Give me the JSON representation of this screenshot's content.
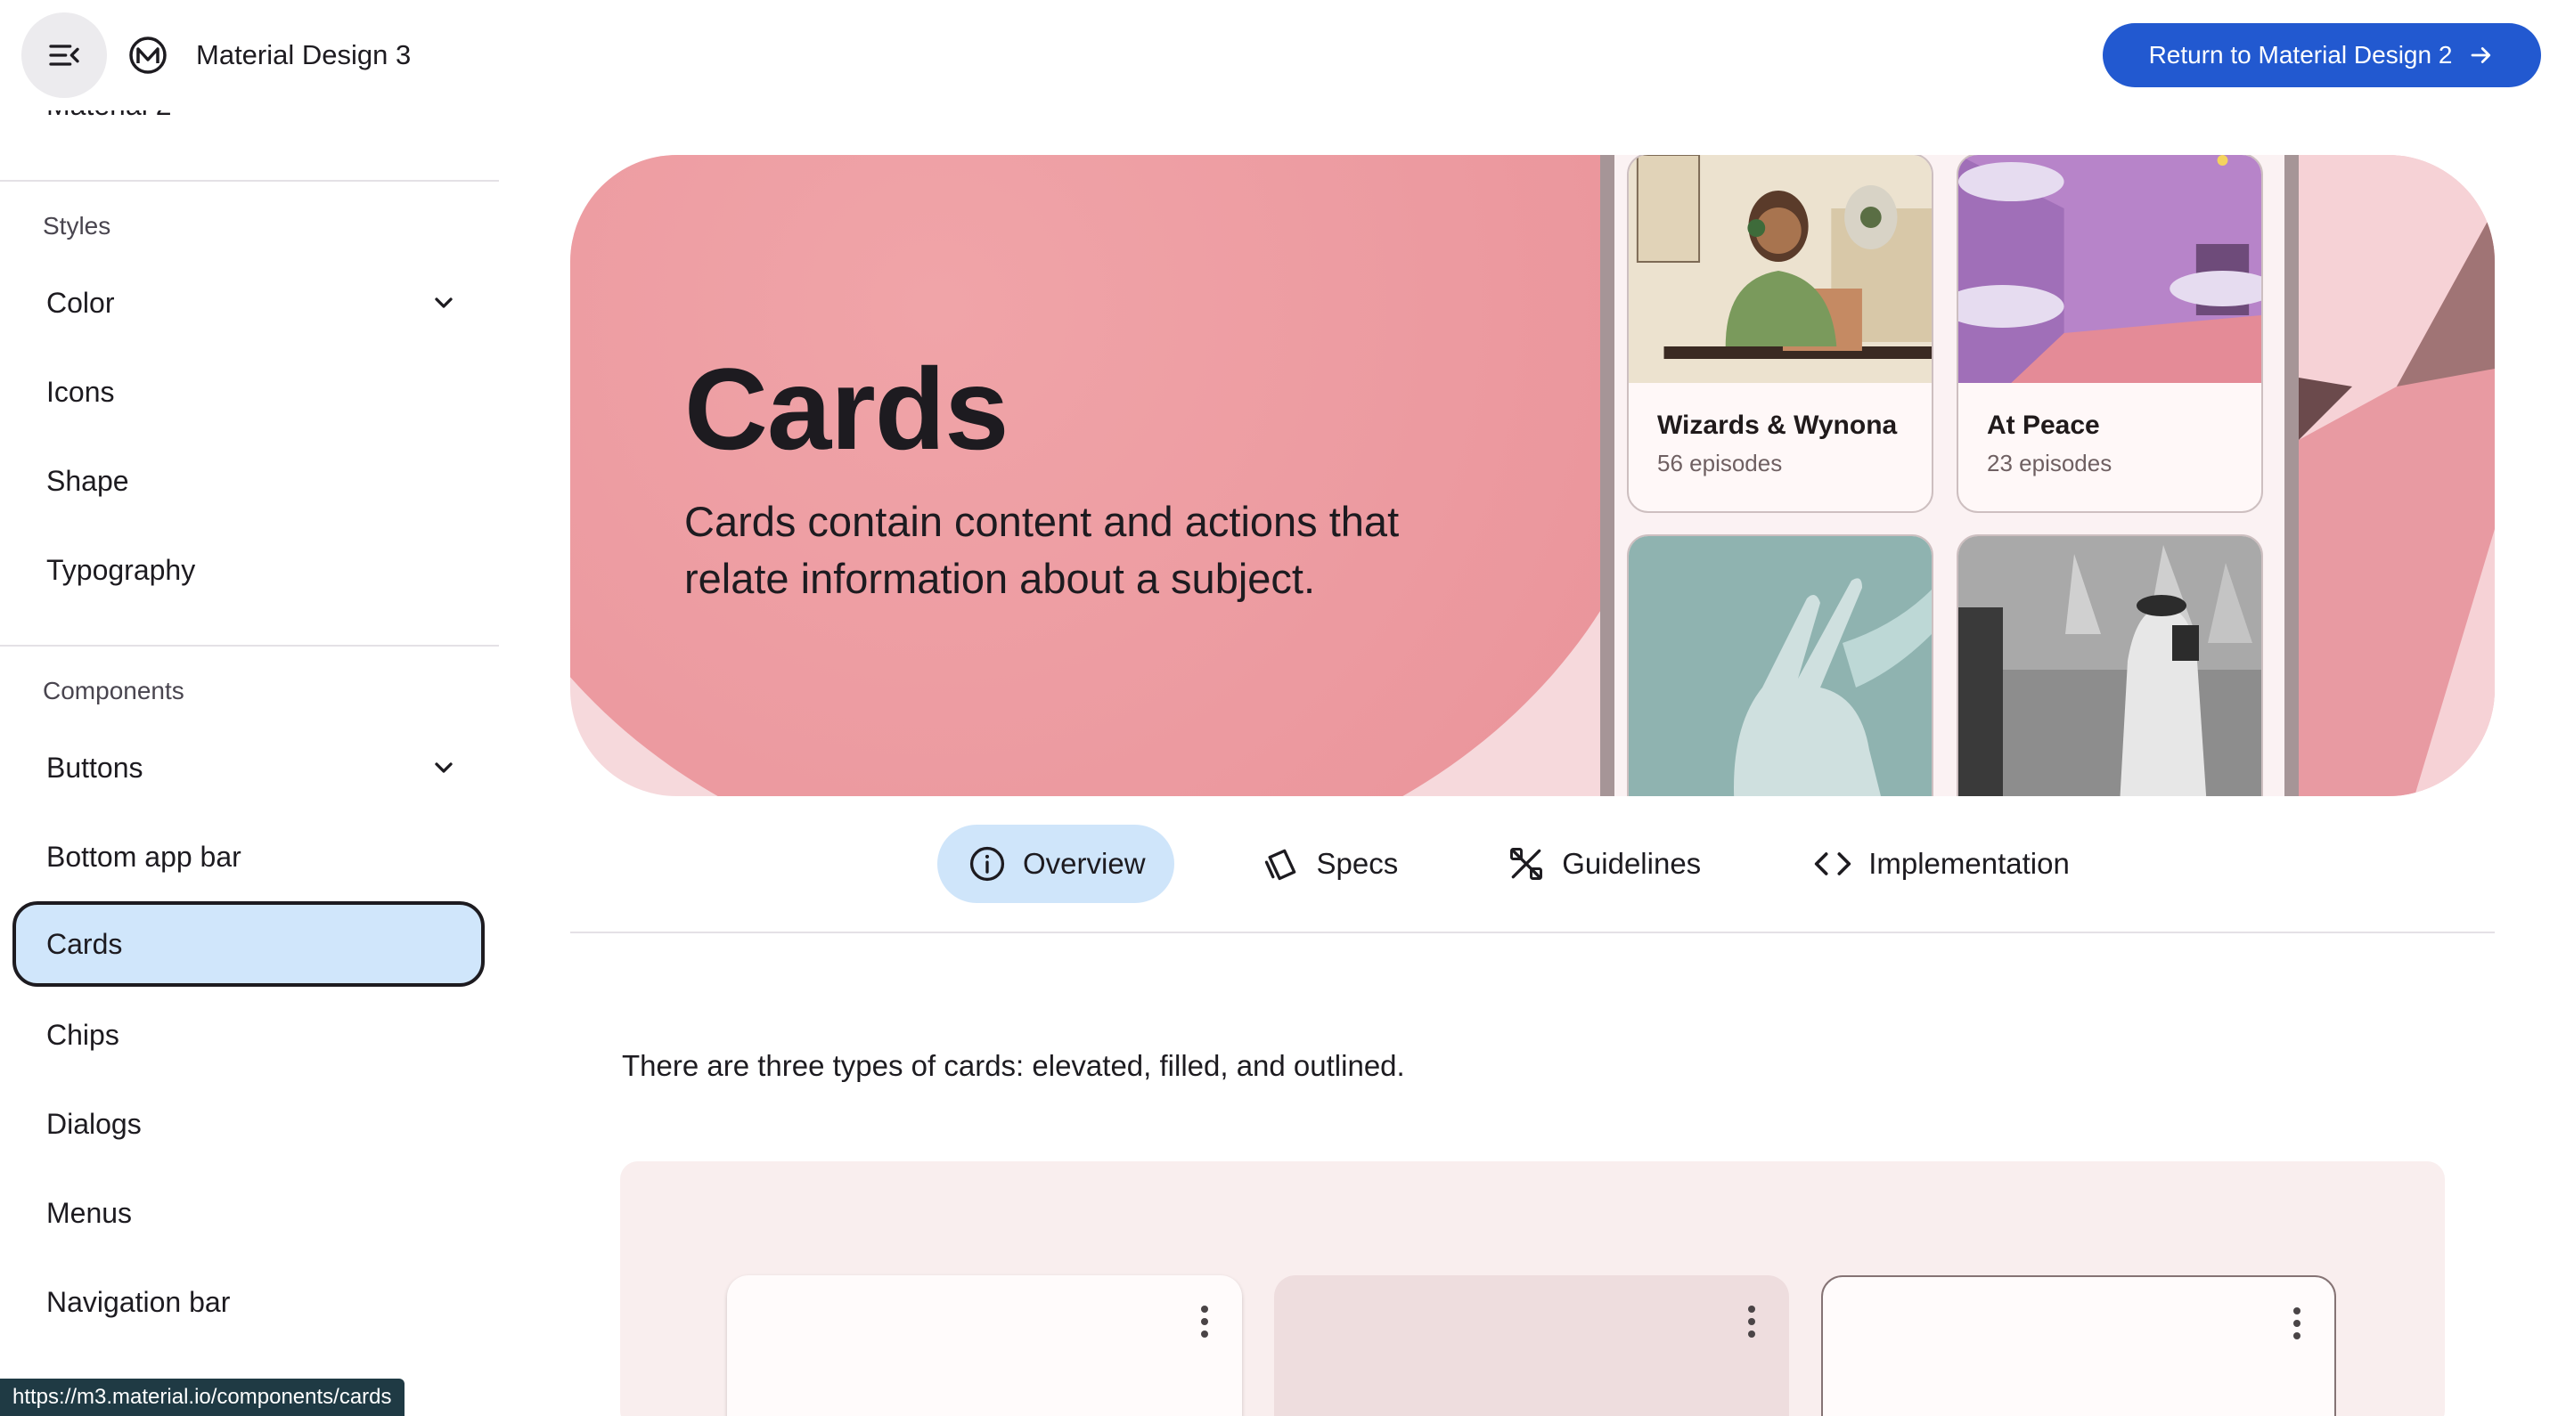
{
  "app": {
    "title": "Material Design 3",
    "return_label": "Return to Material Design 2",
    "colors": {
      "accent": "#2259d0",
      "active_nav": "#d0e6fb",
      "hero_bg": "#f6d9dc"
    }
  },
  "sidebar": {
    "partial_item": "Material 2",
    "styles_label": "Styles",
    "styles_items": [
      {
        "label": "Color",
        "expandable": true
      },
      {
        "label": "Icons"
      },
      {
        "label": "Shape"
      },
      {
        "label": "Typography"
      }
    ],
    "components_label": "Components",
    "components_items": [
      {
        "label": "Buttons",
        "expandable": true
      },
      {
        "label": "Bottom app bar"
      },
      {
        "label": "Cards",
        "active": true
      },
      {
        "label": "Chips"
      },
      {
        "label": "Dialogs"
      },
      {
        "label": "Menus"
      },
      {
        "label": "Navigation bar"
      }
    ]
  },
  "hero": {
    "title": "Cards",
    "description": "Cards contain content and actions that relate information about a subject.",
    "cards": [
      {
        "title": "Wizards & Wynona",
        "subtitle": "56 episodes"
      },
      {
        "title": "At Peace",
        "subtitle": "23 episodes"
      }
    ]
  },
  "tabs": [
    {
      "label": "Overview",
      "icon": "info-icon",
      "active": true
    },
    {
      "label": "Specs",
      "icon": "specs-icon"
    },
    {
      "label": "Guidelines",
      "icon": "guidelines-icon"
    },
    {
      "label": "Implementation",
      "icon": "code-icon"
    }
  ],
  "content": {
    "intro": "There are three types of cards: elevated, filled, and outlined."
  },
  "status_url": "https://m3.material.io/components/cards"
}
